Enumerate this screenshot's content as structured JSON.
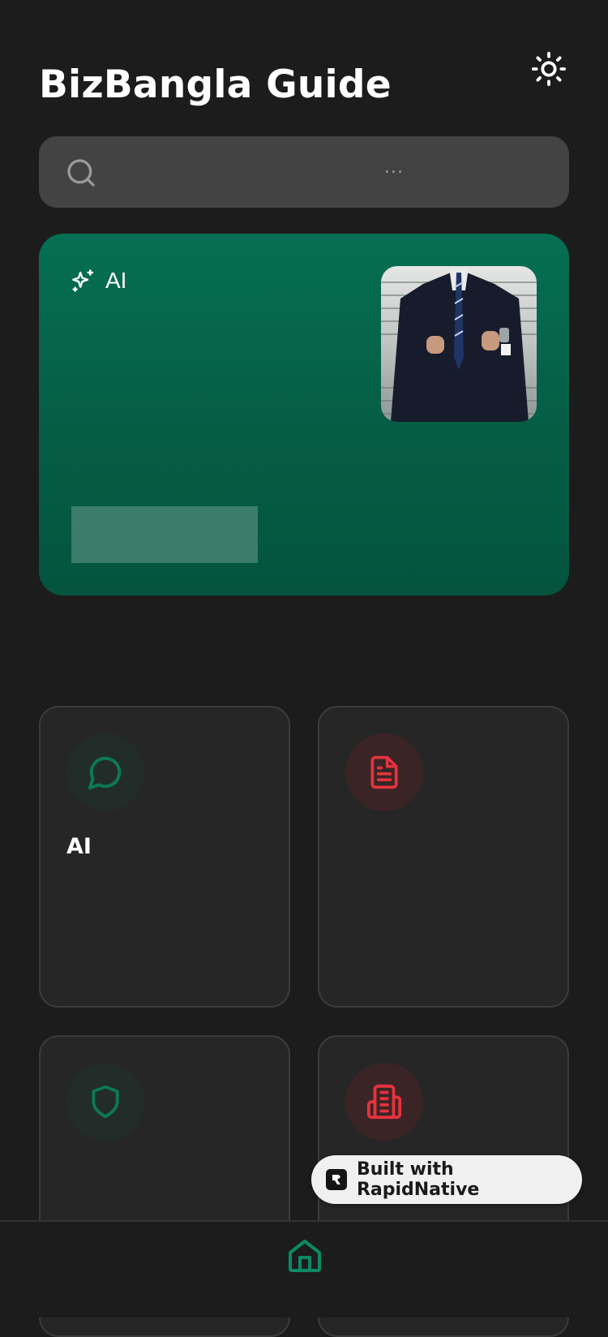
{
  "header": {
    "title": "BizBangla Guide",
    "theme_icon": "sun-icon"
  },
  "search": {
    "icon": "search-icon",
    "placeholder": "..."
  },
  "hero": {
    "tag_icon": "sparkles-icon",
    "tag_label": "AI",
    "photo": "businessman-photo"
  },
  "cards": [
    {
      "icon": "chat-bubble-icon",
      "accent": "#0b7a58",
      "label": "AI"
    },
    {
      "icon": "document-icon",
      "accent": "#e5333d",
      "label": ""
    },
    {
      "icon": "shield-icon",
      "accent": "#0b7a58",
      "label": ""
    },
    {
      "icon": "building-icon",
      "accent": "#e5333d",
      "label": ""
    }
  ],
  "badge": {
    "label": "Built with RapidNative"
  },
  "tabbar": {
    "home_icon": "home-icon",
    "active_color": "#0b8a63"
  },
  "colors": {
    "background": "#1c1c1d",
    "hero_green": "#066f52",
    "accent_green": "#0b7a58",
    "accent_red": "#e5333d"
  }
}
